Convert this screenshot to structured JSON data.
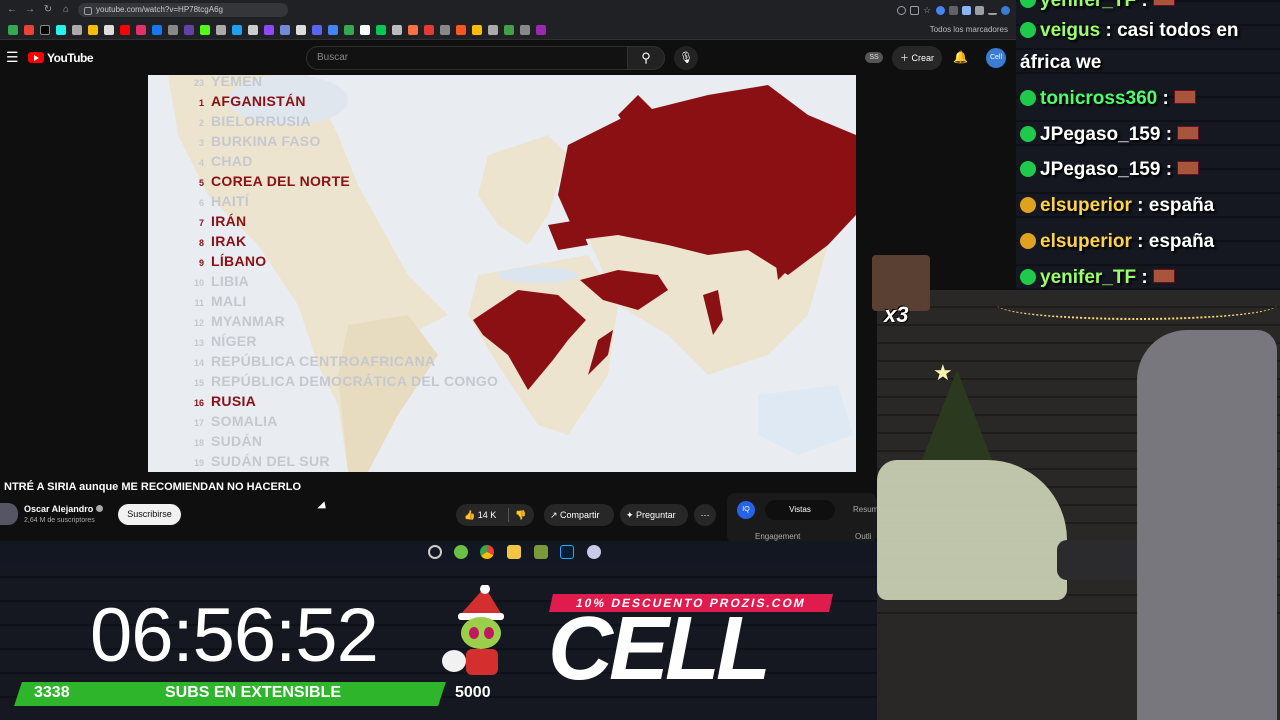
{
  "browser": {
    "url": "youtube.com/watch?v=HP78tcgA6g",
    "bookmarks_folder": "Todos los marcadores"
  },
  "youtube": {
    "logo_text": "YouTube",
    "search_placeholder": "Buscar",
    "ss_badge": "SS",
    "create_label": "Crear",
    "avatar_text": "Cell"
  },
  "video": {
    "countries": [
      {
        "num": "23",
        "name": "YEMEN",
        "highlight": false
      },
      {
        "num": "1",
        "name": "AFGANISTÁN",
        "highlight": true
      },
      {
        "num": "2",
        "name": "BIELORRUSIA",
        "highlight": false
      },
      {
        "num": "3",
        "name": "BURKINA FASO",
        "highlight": false
      },
      {
        "num": "4",
        "name": "CHAD",
        "highlight": false
      },
      {
        "num": "5",
        "name": "COREA DEL NORTE",
        "highlight": true
      },
      {
        "num": "6",
        "name": "HAITÍ",
        "highlight": false
      },
      {
        "num": "7",
        "name": "IRÁN",
        "highlight": true
      },
      {
        "num": "8",
        "name": "IRAK",
        "highlight": true
      },
      {
        "num": "9",
        "name": "LÍBANO",
        "highlight": true
      },
      {
        "num": "10",
        "name": "LIBIA",
        "highlight": false
      },
      {
        "num": "11",
        "name": "MALI",
        "highlight": false
      },
      {
        "num": "12",
        "name": "MYANMAR",
        "highlight": false
      },
      {
        "num": "13",
        "name": "NÍGER",
        "highlight": false
      },
      {
        "num": "14",
        "name": "REPÚBLICA CENTROAFRICANA",
        "highlight": false
      },
      {
        "num": "15",
        "name": "REPÚBLICA DEMOCRÁTICA DEL CONGO",
        "highlight": false
      },
      {
        "num": "16",
        "name": "RUSIA",
        "highlight": true
      },
      {
        "num": "17",
        "name": "SOMALIA",
        "highlight": false
      },
      {
        "num": "18",
        "name": "SUDÁN",
        "highlight": false
      },
      {
        "num": "19",
        "name": "SUDÁN DEL SUR",
        "highlight": false
      }
    ],
    "title": "NTRÉ A SIRIA aunque ME RECOMIENDAN NO HACERLO",
    "channel_name": "Oscar Alejandro",
    "subscribers": "2,64 M de suscriptores",
    "subscribe_label": "Suscribirse",
    "likes": "14 K",
    "share_label": "Compartir",
    "ask_label": "Preguntar",
    "more_label": "⋯"
  },
  "side_panel": {
    "iq_label": "IQ",
    "tab_views": "Vistas",
    "tab_summary": "Resum",
    "engagement": "Engagement",
    "outline": "Outli"
  },
  "chat": [
    {
      "user": "yenifer_TF",
      "sep": " : ",
      "text": ""
    },
    {
      "user": "veigus",
      "sep": " : ",
      "text": "casi todos en"
    },
    {
      "user": "",
      "sep": "",
      "text": "áfrica we"
    },
    {
      "user": "tonicross360",
      "sep": " : ",
      "text": ""
    },
    {
      "user": "JPegaso_159",
      "sep": " : ",
      "text": ""
    },
    {
      "user": "JPegaso_159",
      "sep": " : ",
      "text": ""
    },
    {
      "user": "elsuperior",
      "sep": " : ",
      "text": "españa"
    },
    {
      "user": "elsuperior",
      "sep": " : ",
      "text": "españa"
    },
    {
      "user": "yenifer_TF",
      "sep": " : ",
      "text": ""
    }
  ],
  "overlay": {
    "x3": "x3",
    "timer": "06:56:52",
    "subs_count": "3338",
    "subs_label": "SUBS EN EXTENSIBLE",
    "goal": "5000",
    "promo": "10% DESCUENTO PROZIS.COM",
    "brand": "CELL"
  },
  "colors": {
    "highlight": "#8b1014",
    "youtube_red": "#ff0000",
    "green_bar": "#2fb52b",
    "promo_pink": "#e01c4f"
  }
}
